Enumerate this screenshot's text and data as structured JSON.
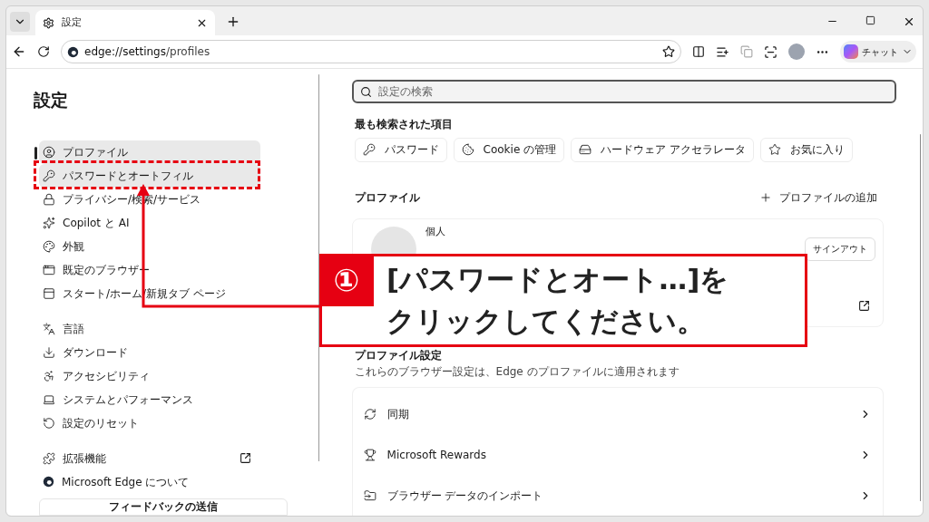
{
  "tabs": [
    {
      "title": "設定",
      "selected": true
    }
  ],
  "address": {
    "url_host": "edge://settings",
    "url_path": "/profiles",
    "favorite": false
  },
  "chat_button": "チャット",
  "sidebar": {
    "title": "設定",
    "sections": [
      [
        {
          "label": "プロファイル",
          "selected": true,
          "highlighted": false
        },
        {
          "label": "パスワードとオートフィル",
          "selected": false,
          "highlighted": true
        },
        {
          "label": "プライバシー/検索/サービス",
          "selected": false,
          "highlighted": false
        },
        {
          "label": "Copilot と AI",
          "selected": false,
          "highlighted": false
        },
        {
          "label": "外観",
          "selected": false,
          "highlighted": false
        },
        {
          "label": "既定のブラウザー",
          "selected": false,
          "highlighted": false
        },
        {
          "label": "スタート/ホーム/新規タブ ページ",
          "selected": false,
          "highlighted": false
        }
      ],
      [
        {
          "label": "言語",
          "selected": false,
          "highlighted": false
        },
        {
          "label": "ダウンロード",
          "selected": false,
          "highlighted": false
        },
        {
          "label": "アクセシビリティ",
          "selected": false,
          "highlighted": false
        },
        {
          "label": "システムとパフォーマンス",
          "selected": false,
          "highlighted": false
        },
        {
          "label": "設定のリセット",
          "selected": false,
          "highlighted": false
        }
      ],
      [
        {
          "label": "拡張機能",
          "selected": false,
          "highlighted": false,
          "external": true
        },
        {
          "label": "Microsoft Edge について",
          "selected": false,
          "highlighted": false,
          "external": false
        }
      ]
    ],
    "feedback_button": "フィードバックの送信"
  },
  "search": {
    "placeholder": "設定の検索"
  },
  "most_searched": {
    "title": "最も検索された項目",
    "chips": [
      "パスワード",
      "Cookie の管理",
      "ハードウェア アクセラレータ",
      "お気に入り"
    ]
  },
  "profile": {
    "heading": "プロファイル",
    "add_button": "プロファイルの追加",
    "name": "個人",
    "sign_out": "サインアウト"
  },
  "profile_settings": {
    "title": "プロファイル設定",
    "subtitle": "これらのブラウザー設定は、Edge のプロファイルに適用されます",
    "rows": [
      "同期",
      "Microsoft Rewards",
      "ブラウザー データのインポート"
    ]
  },
  "callout": {
    "number": "①",
    "lines": [
      "[パスワードとオート…]を",
      "クリックしてください。"
    ]
  }
}
